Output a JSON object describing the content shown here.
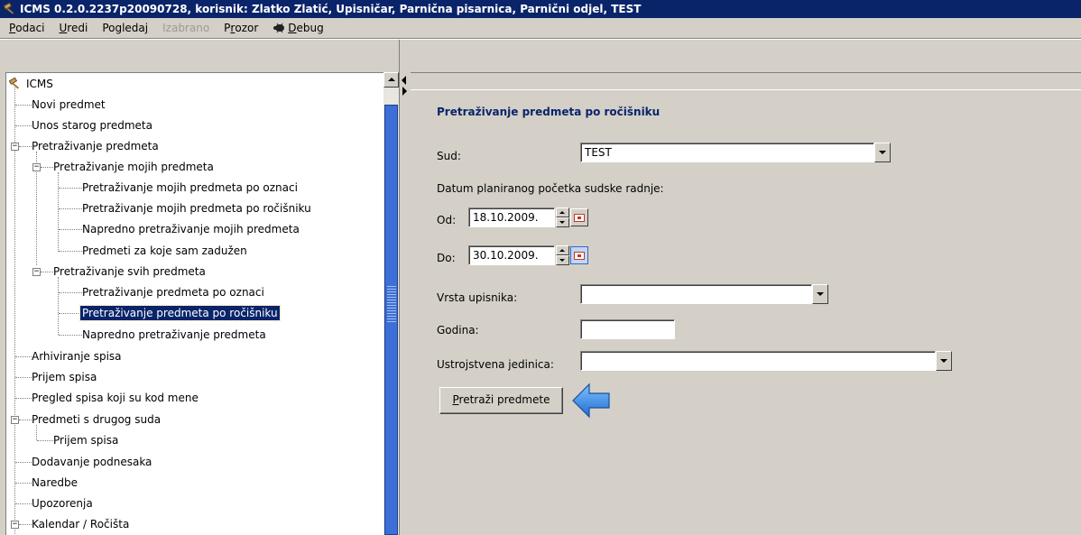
{
  "window": {
    "title": "ICMS 0.2.0.2237p20090728, korisnik: Zlatko Zlatić, Upisničar, Parnična pisarnica, Parnični odjel, TEST"
  },
  "menu": {
    "items": [
      {
        "label": "Podaci",
        "accel": "P",
        "rest": "odaci",
        "disabled": false
      },
      {
        "label": "Uredi",
        "accel": "U",
        "rest": "redi",
        "disabled": false
      },
      {
        "label": "Pogledaj",
        "pre": "Pogleda",
        "accel": "j",
        "disabled": false
      },
      {
        "label": "Izabrano",
        "disabled": true
      },
      {
        "label": "Prozor",
        "pre": "P",
        "accel": "r",
        "rest": "ozor",
        "disabled": false
      },
      {
        "label": "Debug",
        "accel": "D",
        "rest": "ebug",
        "icon": "bug-icon",
        "disabled": false
      }
    ]
  },
  "tree": {
    "root": "ICMS",
    "items": [
      {
        "label": "Novi predmet"
      },
      {
        "label": "Unos starog predmeta"
      },
      {
        "label": "Pretraživanje predmeta"
      },
      {
        "label": "Pretraživanje mojih predmeta"
      },
      {
        "label": "Pretraživanje mojih predmeta po oznaci"
      },
      {
        "label": "Pretraživanje mojih predmeta po ročišniku"
      },
      {
        "label": "Napredno pretraživanje mojih predmeta"
      },
      {
        "label": "Predmeti za koje sam zadužen"
      },
      {
        "label": "Pretraživanje svih predmeta"
      },
      {
        "label": "Pretraživanje predmeta po oznaci"
      },
      {
        "label": "Pretraživanje predmeta po ročišniku"
      },
      {
        "label": "Napredno pretraživanje predmeta"
      },
      {
        "label": "Arhiviranje spisa"
      },
      {
        "label": "Prijem spisa"
      },
      {
        "label": "Pregled spisa koji su kod mene"
      },
      {
        "label": "Predmeti s drugog suda"
      },
      {
        "label": "Prijem spisa"
      },
      {
        "label": "Dodavanje podnesaka"
      },
      {
        "label": "Naredbe"
      },
      {
        "label": "Upozorenja"
      },
      {
        "label": "Kalendar / Ročišta"
      }
    ]
  },
  "form": {
    "title": "Pretraživanje predmeta po ročišniku",
    "sud_label": "Sud:",
    "sud_value": "TEST",
    "datum_label": "Datum planiranog početka sudske radnje:",
    "od_label": "Od:",
    "od_value": "18.10.2009.",
    "do_label": "Do:",
    "do_value": "30.10.2009.",
    "vrsta_label": "Vrsta upisnika:",
    "vrsta_value": "",
    "godina_label": "Godina:",
    "godina_value": "",
    "ustroj_label": "Ustrojstvena jedinica:",
    "ustroj_value": "",
    "search_button_accel": "P",
    "search_button_rest": "retraži predmete"
  },
  "colors": {
    "titlebar": "#0a246a",
    "selection": "#0a246a",
    "form_title": "#0a246a",
    "pointer_arrow": "#3a8ee6"
  }
}
